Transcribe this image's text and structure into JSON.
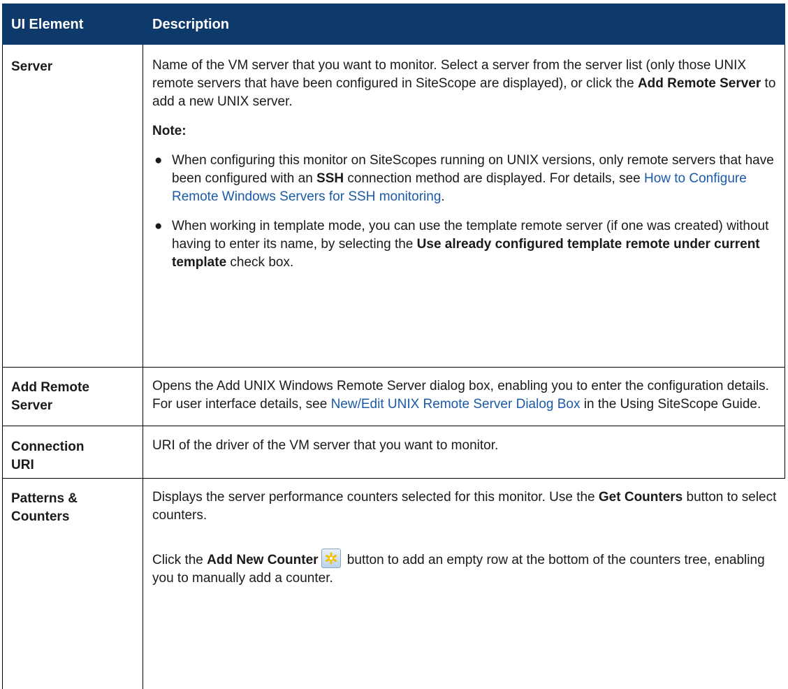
{
  "header": {
    "col1": "UI Element",
    "col2": "Description"
  },
  "rows": {
    "server": {
      "label": "Server",
      "p1_a": "Name of the VM server that you want to monitor. Select a server from the server list (only those UNIX remote servers that have been configured in SiteScope are displayed), or click the ",
      "p1_b": "Add Remote Server",
      "p1_c": " to add a new UNIX server.",
      "note": "Note:",
      "b1_a": "When configuring this monitor on SiteScopes running on UNIX versions, only remote servers that have been configured with an ",
      "b1_b": "SSH",
      "b1_c": " connection method are displayed. For details, see ",
      "b1_link": "How to Configure Remote Windows Servers for SSH monitoring",
      "b1_d": ".",
      "b2_a": "When working in template mode, you can use the template remote server (if one was created) without having to enter its name, by selecting the ",
      "b2_b": "Use already configured template remote under current template",
      "b2_c": " check box."
    },
    "add_remote": {
      "label_1": "Add Remote",
      "label_2": "Server",
      "p_a": "Opens the Add UNIX Windows Remote Server dialog box, enabling you to enter the configuration details. For user interface details, see ",
      "p_link": "New/Edit UNIX Remote Server Dialog Box",
      "p_b": " in the Using SiteScope Guide."
    },
    "connection": {
      "label_1": "Connection",
      "label_2": "URI",
      "p": "URI of the driver of the VM server that you want to monitor."
    },
    "patterns": {
      "label_1": "Patterns &",
      "label_2": "Counters",
      "p1_a": "Displays the server performance counters selected for this monitor. Use the ",
      "p1_b": "Get Counters",
      "p1_c": " button to select counters.",
      "p2_a": "Click the ",
      "p2_b": "Add New Counter",
      "p2_c": " button to add an empty row at the bottom of the counters tree, enabling you to manually add a counter."
    }
  },
  "icons": {
    "add_counter": "asterisk-add-icon"
  },
  "colors": {
    "header_bg": "#0d3a6b",
    "link": "#1a5aa8",
    "icon_star": "#f2c200"
  }
}
